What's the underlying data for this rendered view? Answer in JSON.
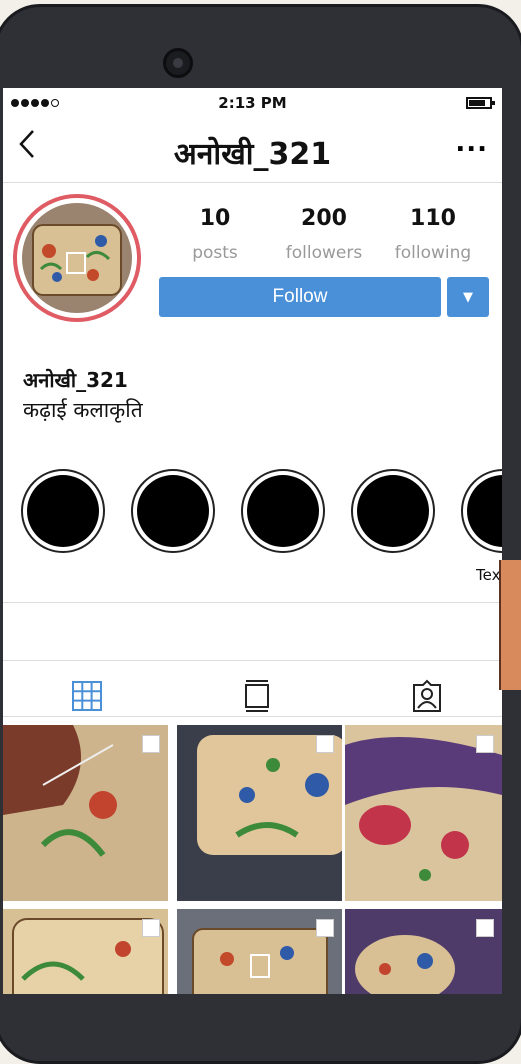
{
  "status_bar": {
    "time": "2:13 PM"
  },
  "header": {
    "username": "अनोखी_321",
    "back_icon": "chevron-left-icon",
    "more_icon": "ellipsis-icon",
    "more_label": "..."
  },
  "stats": [
    {
      "value": "10",
      "label": "posts"
    },
    {
      "value": "200",
      "label": "followers"
    },
    {
      "value": "110",
      "label": "following"
    }
  ],
  "actions": {
    "follow_label": "Follow",
    "dropdown_glyph": "▼"
  },
  "profile": {
    "name": "अनोखी_321",
    "bio": "कढ़ाई कलाकृति"
  },
  "highlights": {
    "visible_label": "Tex"
  },
  "tabs": [
    {
      "icon": "grid-icon",
      "active": true
    },
    {
      "icon": "feed-icon",
      "active": false
    },
    {
      "icon": "tagged-user-icon",
      "active": false
    }
  ],
  "colors": {
    "accent": "#4a90d9",
    "story_ring": "#e05c64"
  }
}
